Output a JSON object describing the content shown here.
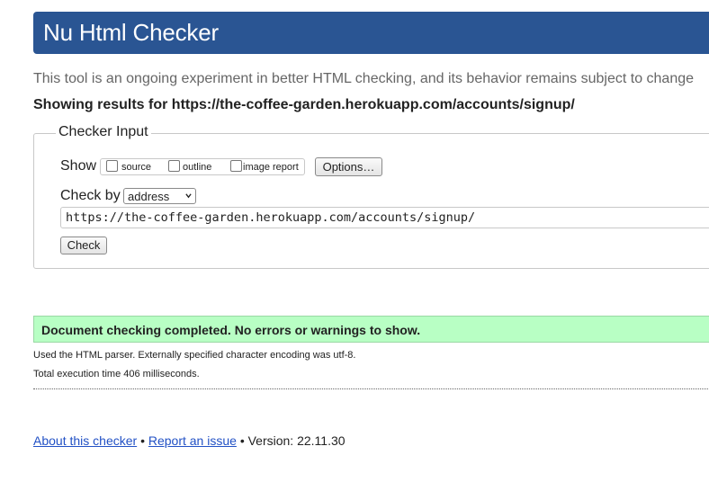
{
  "header": {
    "title": "Nu Html Checker",
    "brand_color": "#2a5593"
  },
  "tagline": "This tool is an ongoing experiment in better HTML checking, and its behavior remains subject to change",
  "showing_results": "Showing results for https://the-coffee-garden.herokuapp.com/accounts/signup/",
  "checker_input": {
    "legend": "Checker Input",
    "show_label": "Show",
    "show_options": [
      {
        "label": "source",
        "checked": false
      },
      {
        "label": "outline",
        "checked": false
      },
      {
        "label": "image report",
        "checked": false
      }
    ],
    "options_button": "Options…",
    "check_by_label": "Check by",
    "check_by_selected": "address",
    "url_value": "https://the-coffee-garden.herokuapp.com/accounts/signup/",
    "check_button": "Check"
  },
  "result": {
    "success_message": "Document checking completed. No errors or warnings to show.",
    "success_color": "#b8ffc4",
    "parser_info": "Used the HTML parser. Externally specified character encoding was utf-8.",
    "execution_time": "Total execution time 406 milliseconds."
  },
  "footer": {
    "about_link": "About this checker",
    "separator": "•",
    "report_link": "Report an issue",
    "version": "Version: 22.11.30"
  }
}
